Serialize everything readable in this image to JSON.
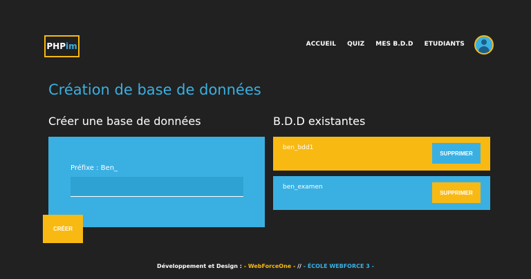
{
  "colors": {
    "background": "#212121",
    "accent_blue": "#3ab0e2",
    "accent_yellow": "#f8b913"
  },
  "logo": {
    "part1": "PHP",
    "part2": "im"
  },
  "nav": {
    "items": [
      "ACCUEIL",
      "QUIZ",
      "MES B.D.D",
      "ETUDIANTS"
    ],
    "avatar_icon": "user-avatar-icon"
  },
  "page_title": "Création de base de données",
  "create_section": {
    "title": "Créer une base de données",
    "prefix_label": "Préfixe : Ben_",
    "input_value": "",
    "create_button": "CRÉER"
  },
  "existing_section": {
    "title": "B.D.D existantes",
    "databases": [
      {
        "name": "ben_bdd1",
        "button": "SUPPRIMER"
      },
      {
        "name": "ben_examen",
        "button": "SUPPRIMER"
      }
    ]
  },
  "footer": {
    "prefix": "Développement et Design : ",
    "credit1": "- WebForceOne -",
    "separator": " // ",
    "credit2": "- ÉCOLE WEBFORCE 3 -"
  }
}
